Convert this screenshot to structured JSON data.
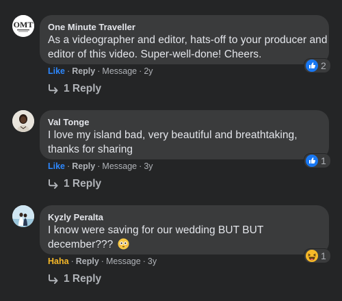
{
  "comments": [
    {
      "author": "One Minute Traveller",
      "avatar_text": "OMT",
      "text": "As a videographer and editor, hats-off to your producer and editor of this video. Super-well-done! Cheers.",
      "actions": {
        "reaction": "Like",
        "reply": "Reply",
        "message": "Message",
        "time": "2y"
      },
      "reaction_icon": "like-icon",
      "reaction_count": "2",
      "replies_label": "1 Reply"
    },
    {
      "author": "Val Tonge",
      "text": "I love my island bad, very beautiful and breathtaking, thanks for sharing",
      "actions": {
        "reaction": "Like",
        "reply": "Reply",
        "message": "Message",
        "time": "3y"
      },
      "reaction_icon": "like-icon",
      "reaction_count": "1",
      "replies_label": "1 Reply"
    },
    {
      "author": "Kyzly Peralta",
      "text": "I know were saving for our wedding BUT BUT december???",
      "inline_emoji": "flushed-face-emoji",
      "actions": {
        "reaction": "Haha",
        "reply": "Reply",
        "message": "Message",
        "time": "3y"
      },
      "reaction_icon": "haha-icon",
      "reaction_count": "1",
      "replies_label": "1 Reply"
    }
  ],
  "colors": {
    "background": "#242526",
    "bubble": "#3a3b3c",
    "text": "#e4e6eb",
    "secondary": "#b0b3b8",
    "like": "#2d88ff",
    "haha": "#f7b928"
  },
  "separator": "·"
}
